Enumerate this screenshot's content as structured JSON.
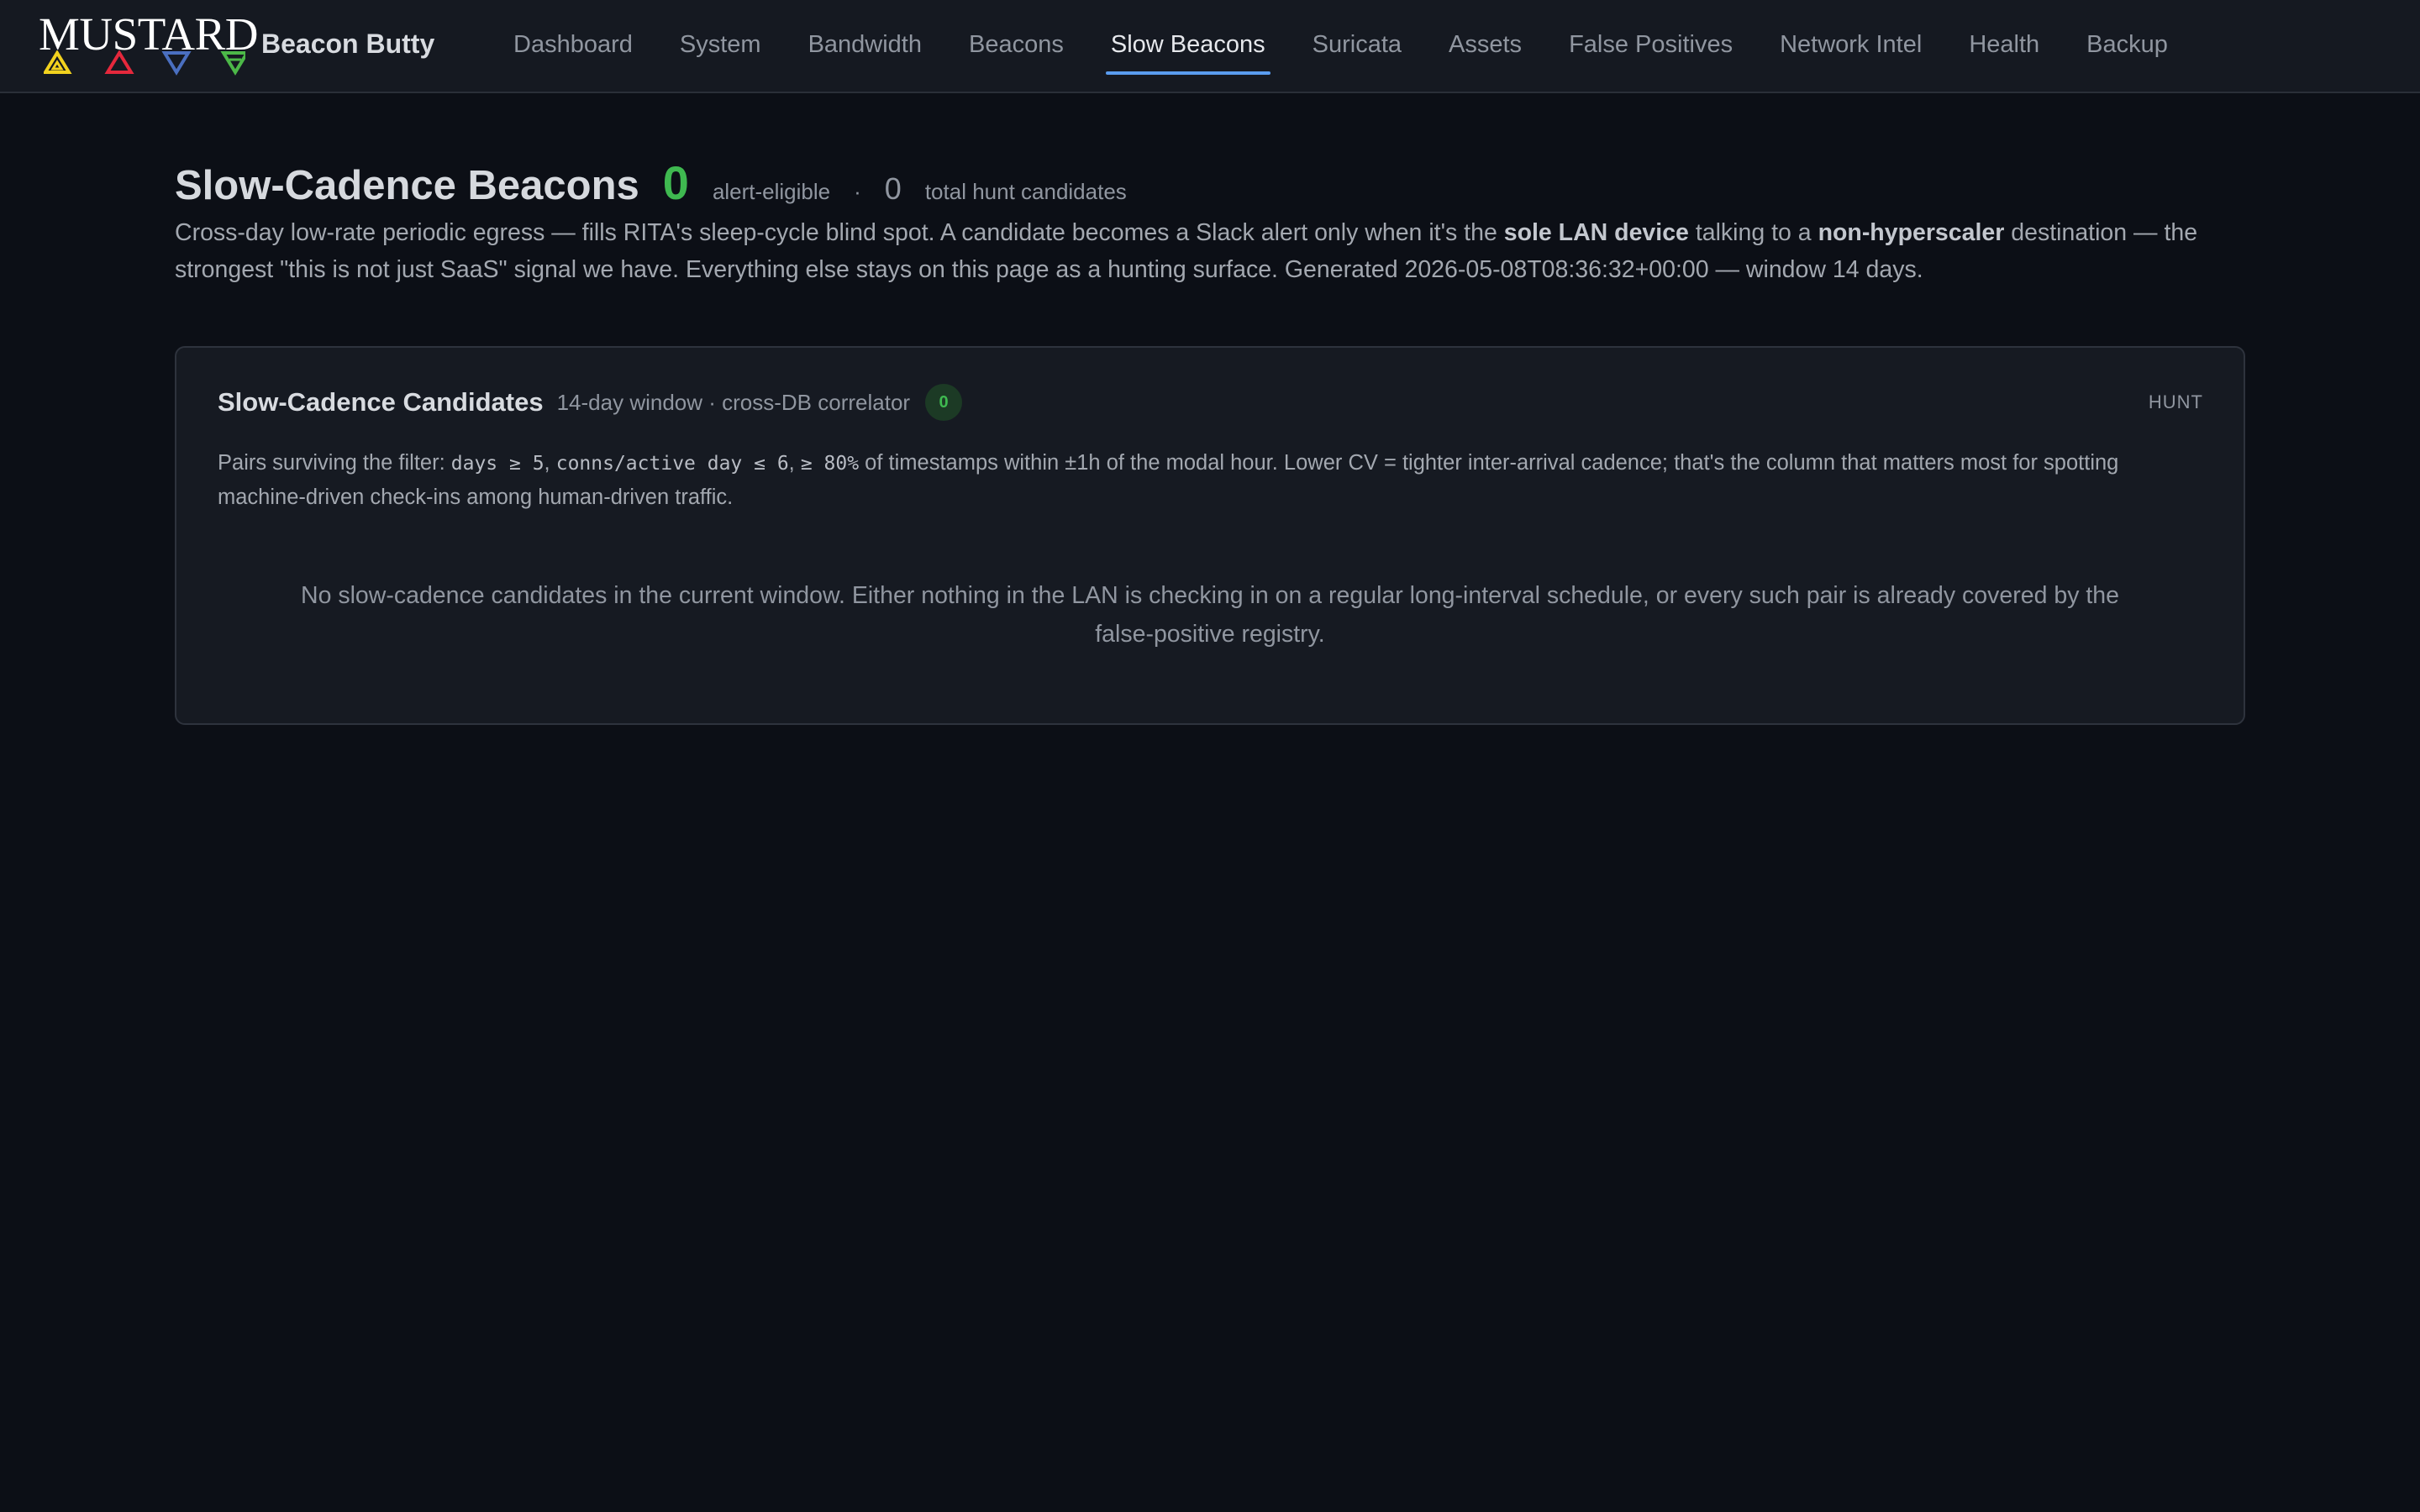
{
  "brand": {
    "logo_text": "MUSTARD",
    "logo_triangle_colors": [
      "#f2d21e",
      "#e5283c",
      "#4a6fc0",
      "#4cb848"
    ],
    "app_name": "Beacon Butty"
  },
  "nav": {
    "items": [
      {
        "label": "Dashboard"
      },
      {
        "label": "System"
      },
      {
        "label": "Bandwidth"
      },
      {
        "label": "Beacons"
      },
      {
        "label": "Slow Beacons",
        "active": true
      },
      {
        "label": "Suricata"
      },
      {
        "label": "Assets"
      },
      {
        "label": "False Positives"
      },
      {
        "label": "Network Intel"
      },
      {
        "label": "Health"
      },
      {
        "label": "Backup"
      }
    ],
    "accent_color": "#5a9cf0"
  },
  "page": {
    "title": "Slow-Cadence Beacons",
    "alert_eligible_count": "0",
    "alert_eligible_label": "alert-eligible",
    "separator": "·",
    "hunt_count": "0",
    "hunt_label": "total hunt candidates",
    "intro": {
      "part1": "Cross-day low-rate periodic egress — fills RITA's sleep-cycle blind spot. A candidate becomes a Slack alert only when it's the ",
      "bold1": "sole LAN device",
      "part2": " talking to a ",
      "bold2": "non-hyperscaler",
      "part3": " destination — the strongest \"this is not just SaaS\" signal we have. Everything else stays on this page as a hunting surface. Generated 2026-05-08T08:36:32+00:00 — window 14 days."
    },
    "count_color": "#3fb950"
  },
  "card": {
    "title": "Slow-Cadence Candidates",
    "subtitle": "14-day window · cross-DB correlator",
    "badge_count": "0",
    "tag": "HUNT",
    "filter": {
      "prefix": "Pairs surviving the filter: ",
      "code1": "days ≥ 5",
      "sep1": ", ",
      "code2": "conns/active day ≤ 6",
      "sep2": ", ",
      "code3": "≥ 80%",
      "suffix": " of timestamps within ±1h of the modal hour. Lower CV = tighter inter-arrival cadence; that's the column that matters most for spotting machine-driven check-ins among human-driven traffic."
    },
    "empty_message": "No slow-cadence candidates in the current window. Either nothing in the LAN is checking in on a regular long-interval schedule, or every such pair is already covered by the false-positive registry."
  }
}
